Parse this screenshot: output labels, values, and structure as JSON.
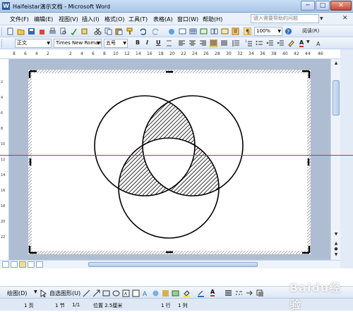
{
  "window": {
    "title": "Haifeistar演示文档 - Microsoft Word",
    "app_icon": "W"
  },
  "window_controls": {
    "minimize": "─",
    "maximize": "□",
    "close": "✕"
  },
  "menu": {
    "items": [
      "文件(F)",
      "编辑(E)",
      "视图(V)",
      "插入(I)",
      "格式(O)",
      "工具(T)",
      "表格(A)",
      "窗口(W)",
      "帮助(H)"
    ],
    "help_placeholder": "键入需要帮助的问题",
    "close_doc": "✕"
  },
  "toolbar": {
    "zoom": "100%",
    "read_label": "阅读(R)"
  },
  "format_toolbar": {
    "style": "正文",
    "font": "Times New Roman",
    "size": "五号",
    "bold": "B",
    "italic": "I",
    "underline": "U",
    "font_color_glyph": "A"
  },
  "ruler": {
    "h_ticks": [
      "8",
      "6",
      "4",
      "2",
      "2",
      "4",
      "6",
      "8",
      "10",
      "12",
      "14",
      "16",
      "18",
      "20",
      "22",
      "24",
      "26",
      "28",
      "30",
      "32",
      "34",
      "36",
      "38",
      "40",
      "42",
      "44",
      "46"
    ],
    "v_ticks": [
      "2",
      "4",
      "6",
      "8",
      "10",
      "12",
      "14",
      "16",
      "18",
      "20",
      "22"
    ]
  },
  "drawing_toolbar": {
    "draw_label": "绘图(D)",
    "autoshapes_label": "自选图形(U)"
  },
  "status": {
    "page": "1 页",
    "section": "1 节",
    "page_of": "1/1",
    "position": "位置 2.5厘米",
    "line": "1 行",
    "column": "1 列"
  },
  "watermark": "Baidu经验",
  "colors": {
    "title_bar": "#b8d3f0",
    "toolbar": "#e4ecf7",
    "document_background": "#aebdd2",
    "hatch": "#000000",
    "guide_line": "#e0262b"
  }
}
